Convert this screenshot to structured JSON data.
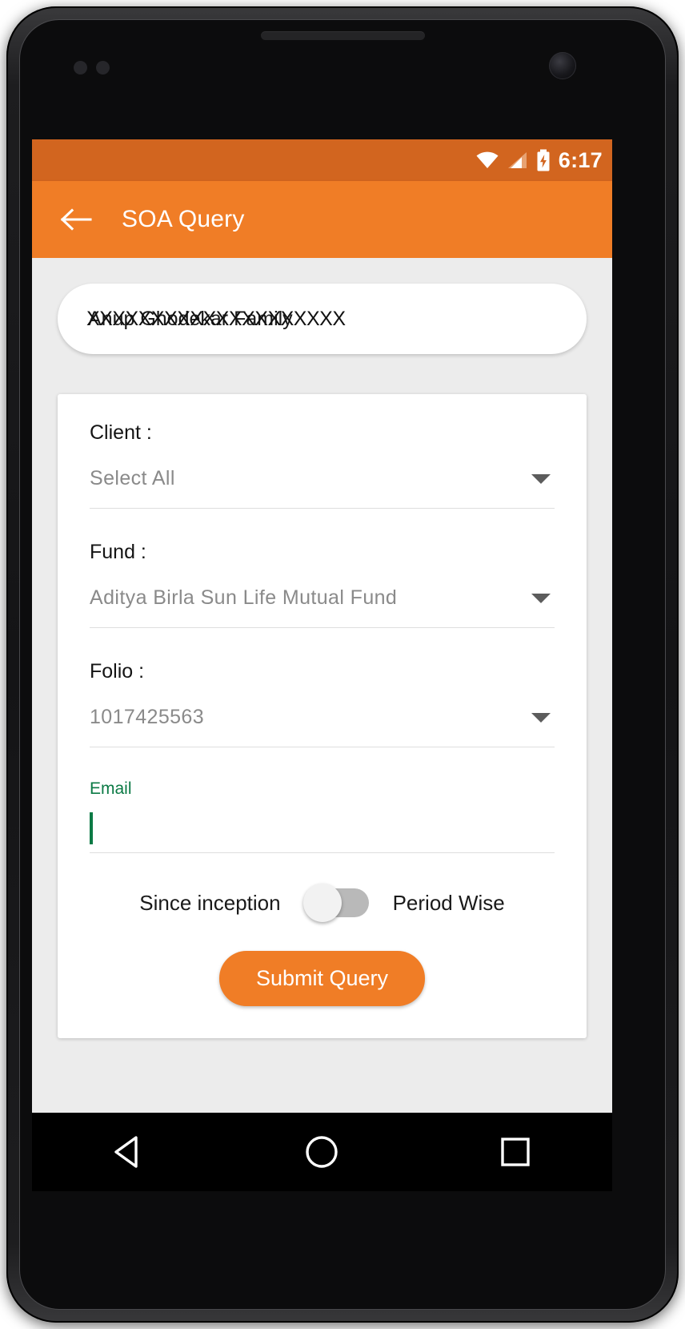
{
  "device": {
    "earpiece": "earpiece-speaker",
    "camera": "front-camera"
  },
  "status_bar": {
    "time": "6:17",
    "icons": [
      "wifi-icon",
      "cellular-signal-icon",
      "battery-charging-icon"
    ],
    "background_color": "#d2651f"
  },
  "app_bar": {
    "title": "SOA Query",
    "back_icon": "arrow-left-icon",
    "background_color": "#f07d26",
    "text_color": "#ffffff"
  },
  "client_pill": {
    "name": "Anup Ghodekar Family",
    "redaction_overlay": "XXXXXXXXXXXXXXXXXXXX"
  },
  "form": {
    "client": {
      "label": "Client :",
      "value": "Select All",
      "caret_icon": "chevron-down-icon"
    },
    "fund": {
      "label": "Fund :",
      "value": "Aditya Birla Sun Life Mutual Fund",
      "caret_icon": "chevron-down-icon"
    },
    "folio": {
      "label": "Folio :",
      "value": "1017425563",
      "caret_icon": "chevron-down-icon"
    },
    "email": {
      "label": "Email",
      "value": "",
      "focus_color": "#0b7a45",
      "focused": true
    },
    "period_toggle": {
      "left_label": "Since inception",
      "right_label": "Period Wise",
      "state": "off",
      "track_color": "#b9b9b9",
      "knob_color": "#f2f2f2"
    },
    "submit": {
      "label": "Submit Query",
      "background_color": "#f07d26",
      "text_color": "#ffffff"
    }
  },
  "nav_bar": {
    "back_icon": "triangle-back-icon",
    "home_icon": "circle-home-icon",
    "recents_icon": "square-recents-icon",
    "background_color": "#000000"
  }
}
